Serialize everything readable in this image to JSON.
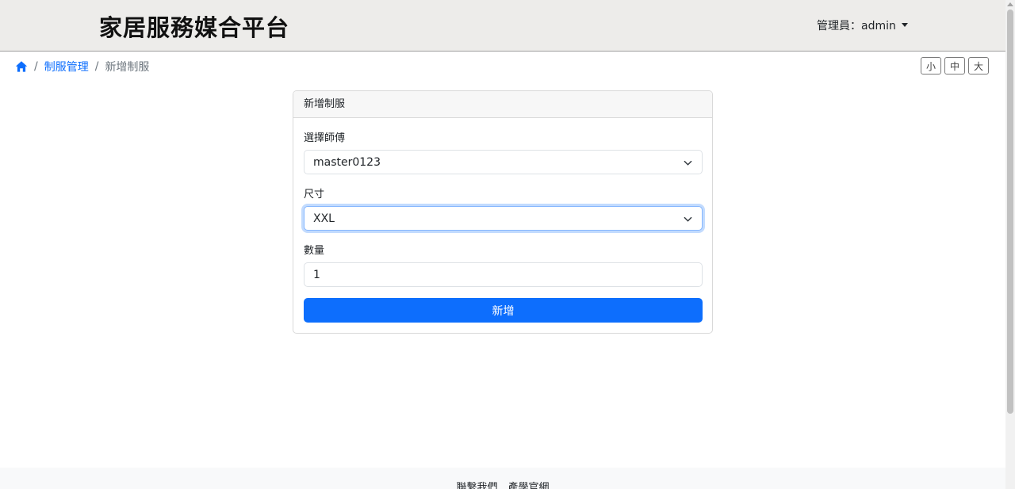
{
  "header": {
    "site_title": "家居服務媒合平台",
    "user_menu_label": "管理員：admin"
  },
  "breadcrumb": {
    "home_icon": "home-icon",
    "section": "制服管理",
    "current": "新增制服",
    "separator": "/"
  },
  "font_size_controls": {
    "small": "小",
    "medium": "中",
    "large": "大"
  },
  "form": {
    "title": "新增制服",
    "master_label": "選擇師傅",
    "master_value": "master0123",
    "size_label": "尺寸",
    "size_value": "XXL",
    "quantity_label": "數量",
    "quantity_value": "1",
    "submit_label": "新增"
  },
  "footer": {
    "text": "聯繫我們．產學官網"
  },
  "colors": {
    "primary": "#0d6efd",
    "header_bg": "#edecea",
    "focus_ring": "#86b7fe"
  }
}
